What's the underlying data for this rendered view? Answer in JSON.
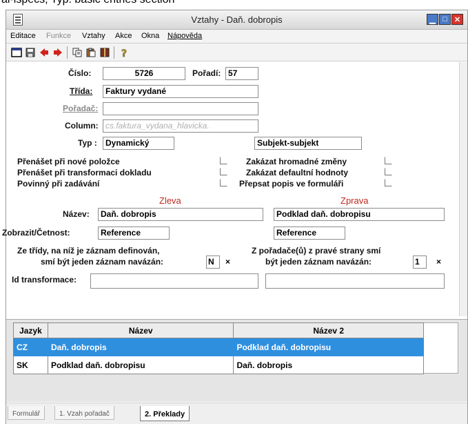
{
  "caption": "ál·ispecs, Typ. basic entries section",
  "window": {
    "title": "Vztahy - Daň. dobropis"
  },
  "menu": [
    "Editace",
    "Funkce",
    "Vztahy",
    "Akce",
    "Okna",
    "Nápověda"
  ],
  "toolbar_icons": [
    "window-icon",
    "save-icon",
    "back-arrow-icon",
    "forward-arrow-icon",
    "copy-icon",
    "paste-icon",
    "book-icon",
    "help-icon"
  ],
  "form": {
    "cislo_label": "Číslo:",
    "cislo_value": "5726",
    "poradi_label": "Pořadí:",
    "poradi_value": "57",
    "trida_label": "Třída:",
    "trida_value": "Faktury vydané",
    "poradac_label": "Pořadač:",
    "poradac_value": "",
    "column_label": "Column:",
    "column_value": "cs.faktura_vydana_hlavicka.",
    "typ_label": "Typ :",
    "typ_value": "Dynamický",
    "typ2_value": "Subjekt-subjekt",
    "check_left": [
      "Přenášet při nové položce",
      "Přenášet při transformaci dokladu",
      "Povinný při zadávání"
    ],
    "check_right": [
      "Zakázat hromadné změny",
      "Zakázat defaultní hodnoty",
      "Přepsat popis ve formuláři"
    ],
    "zleva": "Zleva",
    "zprava": "Zprava",
    "nazev_label": "Název:",
    "nazev_left": "Daň. dobropis",
    "nazev_right": "Podklad daň. dobropisu",
    "zobrazit_label": "Zobrazit/Četnost:",
    "zobrazit_left": "Reference",
    "zobrazit_right": "Reference",
    "ze_tridy_1": "Ze třídy, na níž je záznam definován,",
    "ze_tridy_2": "smí být jeden záznam navázán:",
    "ze_tridy_value": "N",
    "z_poradace_1": "Z pořadače(ů) z pravé strany smí",
    "z_poradace_2": "být jeden záznam navázán:",
    "z_poradace_value": "1",
    "x_mark": "×",
    "id_label": "Id transformace:"
  },
  "grid": {
    "headers": [
      "Jazyk",
      "Název",
      "Název 2"
    ],
    "rows": [
      [
        "CZ",
        "Daň. dobropis",
        "Podklad daň. dobropisu"
      ],
      [
        "SK",
        "Podklad daň. dobropisu",
        "Daň. dobropis"
      ]
    ]
  },
  "tabs": [
    "Formulář",
    "1. Vzah pořadač",
    "2. Překlady"
  ],
  "colors": {
    "selection": "#2f8fdf",
    "accent_red": "#c0271f",
    "close_button": "#d9342a"
  }
}
